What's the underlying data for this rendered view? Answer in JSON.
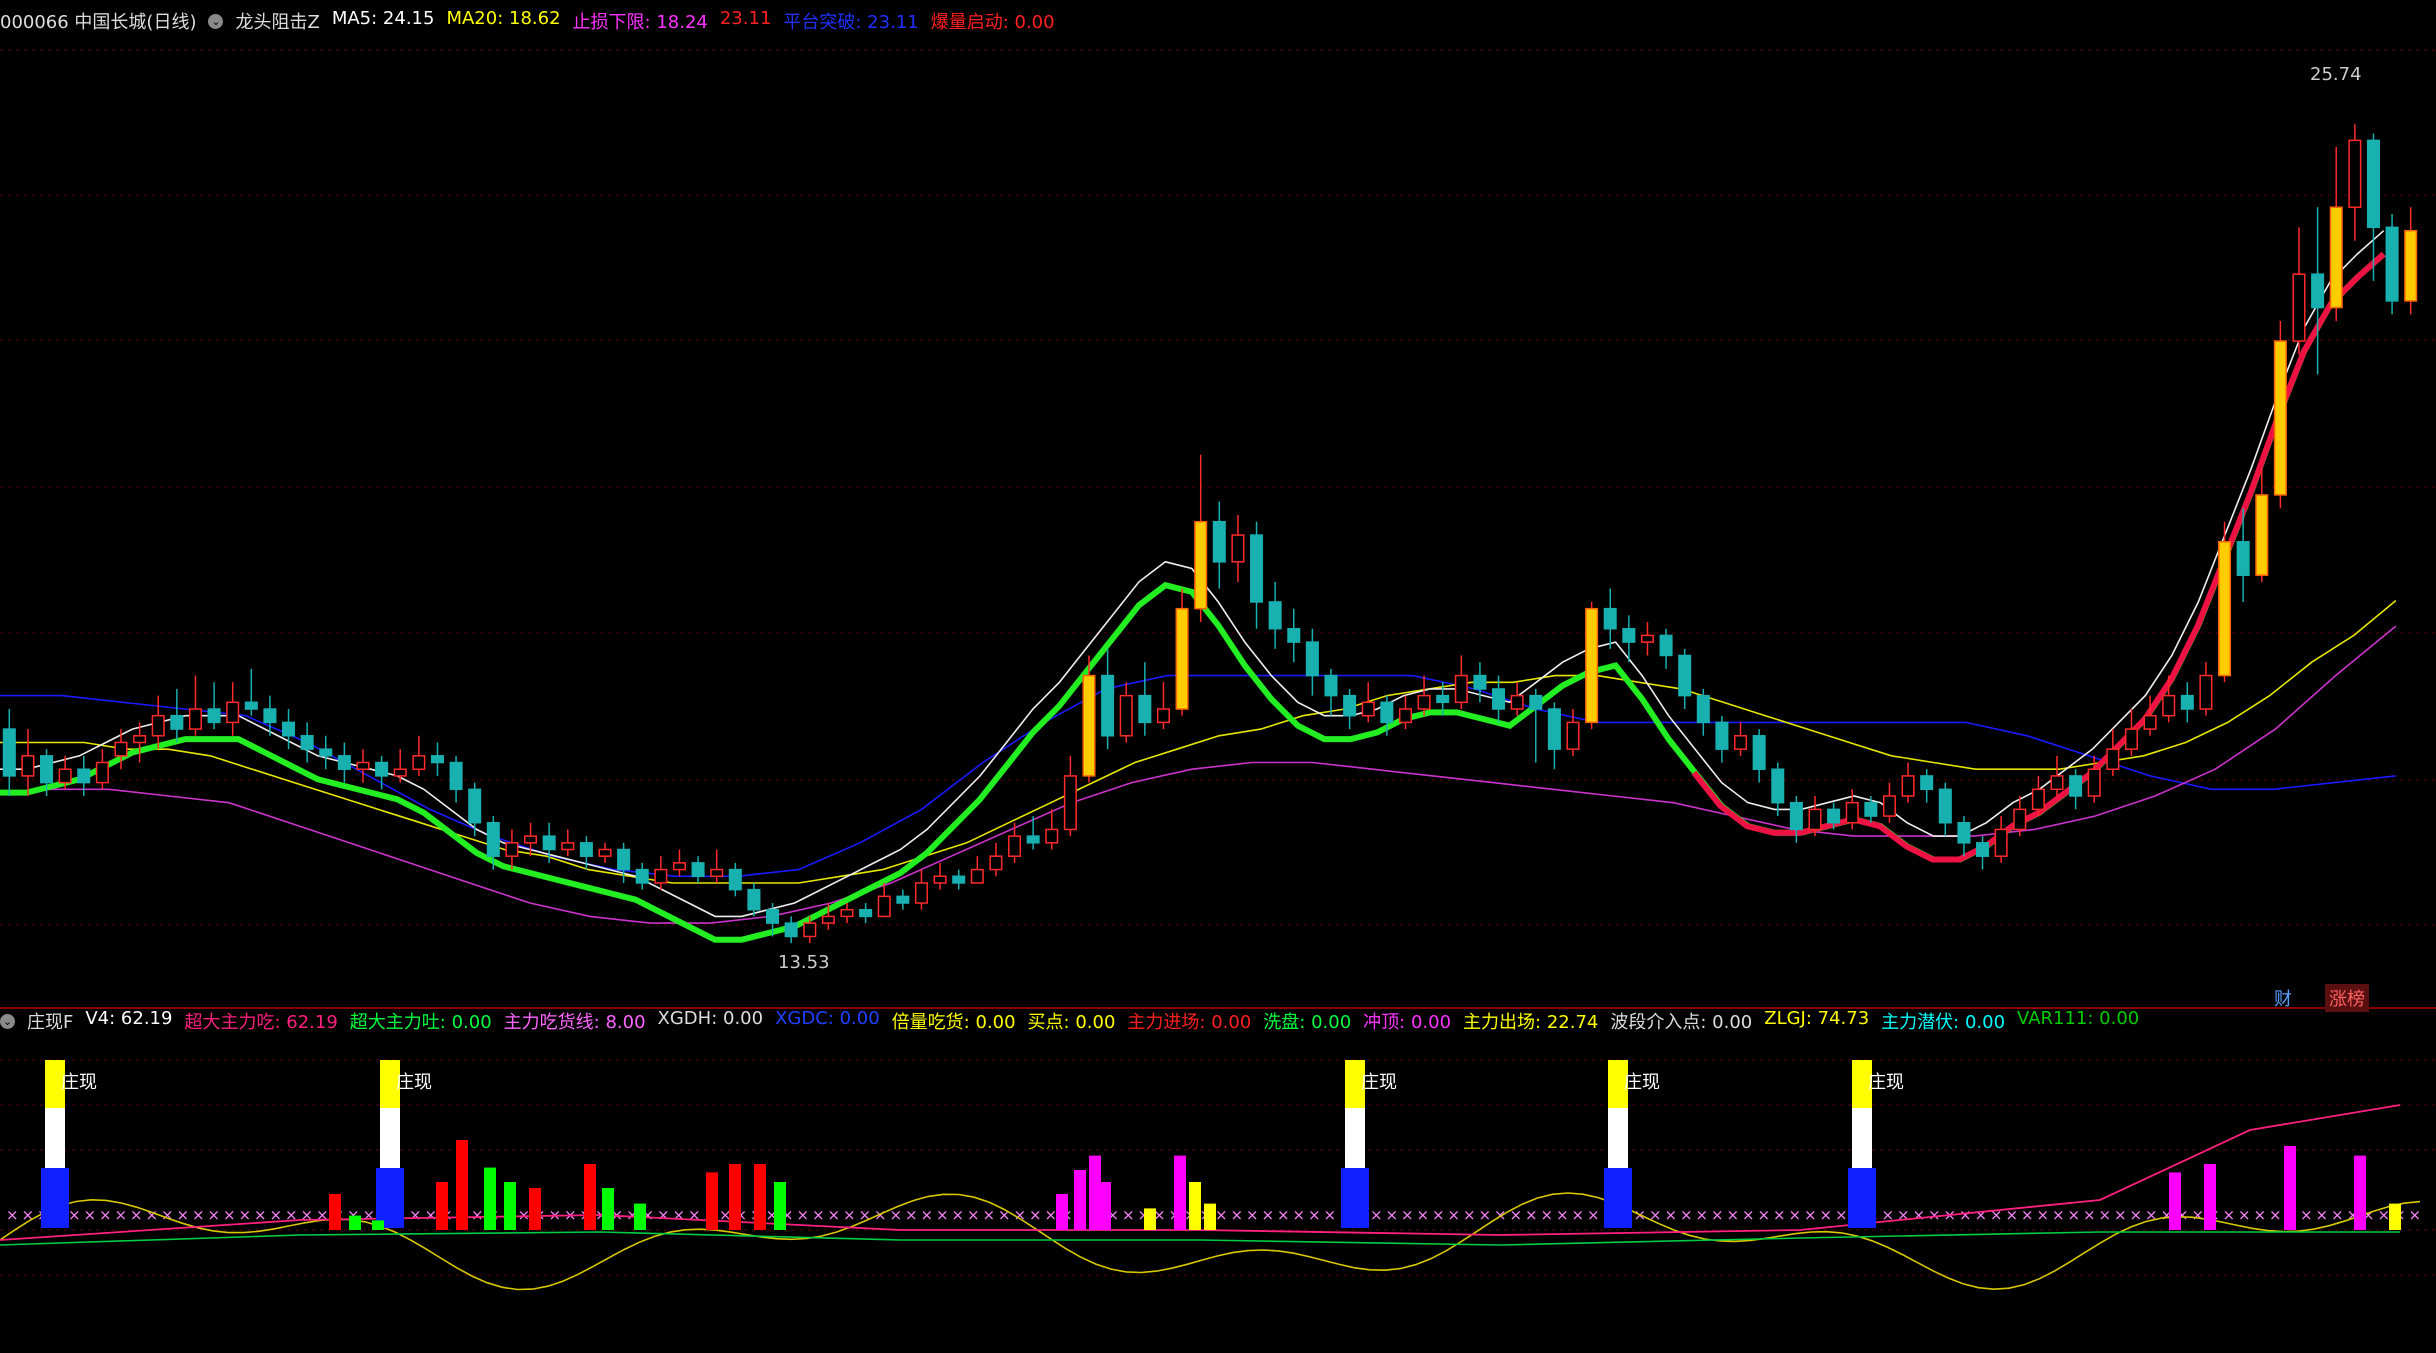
{
  "main_header": {
    "stock": "000066 中国长城(日线)",
    "indicator": "龙头阻击Z",
    "items": [
      {
        "label": "MA5: 24.15",
        "color": "#ffffff"
      },
      {
        "label": "MA20: 18.62",
        "color": "#ffff00"
      },
      {
        "label": "止损下限: 18.24",
        "color": "#ff33ff"
      },
      {
        "label": "23.11",
        "color": "#ff2020"
      },
      {
        "label": "平台突破: 23.11",
        "color": "#2030ff"
      },
      {
        "label": "爆量启动: 0.00",
        "color": "#ff2020"
      }
    ]
  },
  "indicator_header": {
    "name": "庄现F",
    "items": [
      {
        "label": "V4: 62.19",
        "color": "#ffffff"
      },
      {
        "label": "超大主力吃: 62.19",
        "color": "#ff2080"
      },
      {
        "label": "超大主力吐: 0.00",
        "color": "#00ff40"
      },
      {
        "label": "主力吃货线: 8.00",
        "color": "#ff66ff"
      },
      {
        "label": "XGDH: 0.00",
        "color": "#dddddd"
      },
      {
        "label": "XGDC: 0.00",
        "color": "#2040ff"
      },
      {
        "label": "倍量吃货: 0.00",
        "color": "#ffff00"
      },
      {
        "label": "买点: 0.00",
        "color": "#ffff00"
      },
      {
        "label": "主力进场: 0.00",
        "color": "#ff2020"
      },
      {
        "label": "洗盘: 0.00",
        "color": "#00ff40"
      },
      {
        "label": "冲顶: 0.00",
        "color": "#ff33ff"
      },
      {
        "label": "主力出场: 22.74",
        "color": "#ffff00"
      },
      {
        "label": "波段介入点: 0.00",
        "color": "#dddddd"
      },
      {
        "label": "ZLGJ: 74.73",
        "color": "#ffff00"
      },
      {
        "label": "主力潜伏: 0.00",
        "color": "#00ffff"
      },
      {
        "label": "VAR111: 0.00",
        "color": "#00cc00"
      }
    ]
  },
  "badges": {
    "cai": "财",
    "zhang": "涨榜"
  },
  "chart_data": {
    "type": "candlestick",
    "stock": "000066 中国长城",
    "high_label": "25.74",
    "low_label": "13.53",
    "ylim": [
      12.8,
      27.0
    ],
    "candles": [
      [
        16.7,
        16.0,
        17.0,
        15.7
      ],
      [
        16.0,
        16.3,
        16.7,
        15.7
      ],
      [
        16.3,
        15.9,
        16.4,
        15.7
      ],
      [
        15.9,
        16.1,
        16.3,
        15.8
      ],
      [
        16.1,
        15.9,
        16.3,
        15.7
      ],
      [
        15.9,
        16.2,
        16.4,
        15.8
      ],
      [
        16.3,
        16.5,
        16.7,
        16.1
      ],
      [
        16.5,
        16.6,
        16.8,
        16.2
      ],
      [
        16.6,
        16.9,
        17.2,
        16.4
      ],
      [
        16.9,
        16.7,
        17.3,
        16.5
      ],
      [
        16.7,
        17.0,
        17.5,
        16.6
      ],
      [
        17.0,
        16.8,
        17.4,
        16.7
      ],
      [
        16.8,
        17.1,
        17.4,
        16.6
      ],
      [
        17.1,
        17.0,
        17.6,
        16.9
      ],
      [
        17.0,
        16.8,
        17.2,
        16.6
      ],
      [
        16.8,
        16.6,
        17.0,
        16.4
      ],
      [
        16.6,
        16.4,
        16.8,
        16.2
      ],
      [
        16.4,
        16.3,
        16.6,
        16.1
      ],
      [
        16.3,
        16.1,
        16.5,
        15.9
      ],
      [
        16.1,
        16.2,
        16.4,
        15.9
      ],
      [
        16.2,
        16.0,
        16.3,
        15.8
      ],
      [
        16.0,
        16.1,
        16.4,
        15.9
      ],
      [
        16.1,
        16.3,
        16.6,
        16.0
      ],
      [
        16.3,
        16.2,
        16.5,
        16.0
      ],
      [
        16.2,
        15.8,
        16.3,
        15.6
      ],
      [
        15.8,
        15.3,
        15.9,
        15.1
      ],
      [
        15.3,
        14.8,
        15.4,
        14.6
      ],
      [
        14.8,
        15.0,
        15.2,
        14.6
      ],
      [
        15.0,
        15.1,
        15.3,
        14.8
      ],
      [
        15.1,
        14.9,
        15.3,
        14.7
      ],
      [
        14.9,
        15.0,
        15.2,
        14.8
      ],
      [
        15.0,
        14.8,
        15.1,
        14.6
      ],
      [
        14.8,
        14.9,
        15.0,
        14.7
      ],
      [
        14.9,
        14.6,
        15.0,
        14.4
      ],
      [
        14.6,
        14.4,
        14.7,
        14.3
      ],
      [
        14.4,
        14.6,
        14.8,
        14.3
      ],
      [
        14.6,
        14.7,
        14.9,
        14.5
      ],
      [
        14.7,
        14.5,
        14.8,
        14.4
      ],
      [
        14.5,
        14.6,
        14.9,
        14.4
      ],
      [
        14.6,
        14.3,
        14.7,
        14.2
      ],
      [
        14.3,
        14.0,
        14.4,
        13.9
      ],
      [
        14.0,
        13.8,
        14.1,
        13.6
      ],
      [
        13.8,
        13.6,
        13.9,
        13.5
      ],
      [
        13.6,
        13.8,
        13.9,
        13.5
      ],
      [
        13.8,
        13.9,
        14.1,
        13.7
      ],
      [
        13.9,
        14.0,
        14.1,
        13.8
      ],
      [
        14.0,
        13.9,
        14.1,
        13.8
      ],
      [
        13.9,
        14.2,
        14.4,
        13.9
      ],
      [
        14.2,
        14.1,
        14.3,
        14.0
      ],
      [
        14.1,
        14.4,
        14.6,
        14.0
      ],
      [
        14.4,
        14.5,
        14.7,
        14.3
      ],
      [
        14.5,
        14.4,
        14.6,
        14.3
      ],
      [
        14.4,
        14.6,
        14.8,
        14.4
      ],
      [
        14.6,
        14.8,
        15.0,
        14.5
      ],
      [
        14.8,
        15.1,
        15.3,
        14.7
      ],
      [
        15.1,
        15.0,
        15.4,
        14.9
      ],
      [
        15.0,
        15.2,
        15.5,
        14.9
      ],
      [
        15.2,
        16.0,
        16.3,
        15.1
      ],
      [
        16.0,
        17.5,
        17.8,
        15.9
      ],
      [
        17.5,
        16.6,
        17.9,
        16.4
      ],
      [
        16.6,
        17.2,
        17.4,
        16.5
      ],
      [
        17.2,
        16.8,
        17.7,
        16.6
      ],
      [
        16.8,
        17.0,
        17.4,
        16.7
      ],
      [
        17.0,
        18.5,
        18.8,
        16.9
      ],
      [
        18.5,
        19.8,
        20.8,
        18.3
      ],
      [
        19.8,
        19.2,
        20.1,
        18.8
      ],
      [
        19.2,
        19.6,
        19.9,
        18.9
      ],
      [
        19.6,
        18.6,
        19.8,
        18.2
      ],
      [
        18.6,
        18.2,
        18.9,
        17.9
      ],
      [
        18.2,
        18.0,
        18.5,
        17.7
      ],
      [
        18.0,
        17.5,
        18.2,
        17.2
      ],
      [
        17.5,
        17.2,
        17.6,
        16.9
      ],
      [
        17.2,
        16.9,
        17.3,
        16.7
      ],
      [
        16.9,
        17.1,
        17.4,
        16.8
      ],
      [
        17.1,
        16.8,
        17.2,
        16.6
      ],
      [
        16.8,
        17.0,
        17.2,
        16.7
      ],
      [
        17.0,
        17.2,
        17.5,
        16.9
      ],
      [
        17.2,
        17.1,
        17.4,
        16.9
      ],
      [
        17.1,
        17.5,
        17.8,
        17.0
      ],
      [
        17.5,
        17.3,
        17.7,
        17.1
      ],
      [
        17.3,
        17.0,
        17.5,
        16.8
      ],
      [
        17.0,
        17.2,
        17.4,
        16.9
      ],
      [
        17.2,
        17.0,
        17.3,
        16.2
      ],
      [
        17.0,
        16.4,
        17.1,
        16.1
      ],
      [
        16.4,
        16.8,
        17.0,
        16.3
      ],
      [
        16.8,
        18.5,
        18.6,
        16.7
      ],
      [
        18.5,
        18.2,
        18.8,
        17.9
      ],
      [
        18.2,
        18.0,
        18.4,
        17.7
      ],
      [
        18.0,
        18.1,
        18.3,
        17.8
      ],
      [
        18.1,
        17.8,
        18.2,
        17.6
      ],
      [
        17.8,
        17.2,
        17.9,
        17.0
      ],
      [
        17.2,
        16.8,
        17.3,
        16.6
      ],
      [
        16.8,
        16.4,
        16.9,
        16.2
      ],
      [
        16.4,
        16.6,
        16.8,
        16.3
      ],
      [
        16.6,
        16.1,
        16.7,
        15.9
      ],
      [
        16.1,
        15.6,
        16.2,
        15.4
      ],
      [
        15.6,
        15.2,
        15.7,
        15.0
      ],
      [
        15.2,
        15.5,
        15.7,
        15.1
      ],
      [
        15.5,
        15.3,
        15.6,
        15.2
      ],
      [
        15.3,
        15.6,
        15.8,
        15.2
      ],
      [
        15.6,
        15.4,
        15.7,
        15.3
      ],
      [
        15.4,
        15.7,
        15.9,
        15.3
      ],
      [
        15.7,
        16.0,
        16.2,
        15.6
      ],
      [
        16.0,
        15.8,
        16.1,
        15.6
      ],
      [
        15.8,
        15.3,
        15.9,
        15.1
      ],
      [
        15.3,
        15.0,
        15.4,
        14.8
      ],
      [
        15.0,
        14.8,
        15.1,
        14.6
      ],
      [
        14.8,
        15.2,
        15.4,
        14.7
      ],
      [
        15.2,
        15.5,
        15.7,
        15.1
      ],
      [
        15.5,
        15.8,
        16.0,
        15.4
      ],
      [
        15.8,
        16.0,
        16.3,
        15.7
      ],
      [
        16.0,
        15.7,
        16.1,
        15.5
      ],
      [
        15.7,
        16.1,
        16.3,
        15.6
      ],
      [
        16.1,
        16.4,
        16.7,
        16.0
      ],
      [
        16.4,
        16.7,
        17.0,
        16.3
      ],
      [
        16.7,
        16.9,
        17.2,
        16.6
      ],
      [
        16.9,
        17.2,
        17.5,
        16.8
      ],
      [
        17.2,
        17.0,
        17.4,
        16.8
      ],
      [
        17.0,
        17.5,
        17.7,
        16.9
      ],
      [
        17.5,
        19.5,
        19.8,
        17.4
      ],
      [
        19.5,
        19.0,
        20.0,
        18.6
      ],
      [
        19.0,
        20.2,
        20.6,
        18.9
      ],
      [
        20.2,
        22.5,
        22.8,
        20.0
      ],
      [
        22.5,
        23.5,
        24.2,
        22.3
      ],
      [
        23.5,
        23.0,
        24.5,
        22.0
      ],
      [
        23.0,
        24.5,
        25.4,
        22.8
      ],
      [
        24.5,
        25.5,
        25.74,
        24.0
      ],
      [
        25.5,
        24.2,
        25.6,
        23.4
      ],
      [
        24.2,
        23.1,
        24.4,
        22.9
      ],
      [
        23.1,
        24.15,
        24.5,
        22.9
      ]
    ],
    "ma5": [
      16.1,
      16.1,
      16.2,
      16.3,
      16.5,
      16.7,
      16.8,
      16.9,
      16.9,
      16.9,
      16.7,
      16.5,
      16.3,
      16.2,
      16.1,
      16.0,
      15.8,
      15.5,
      15.2,
      15.0,
      14.9,
      14.8,
      14.7,
      14.6,
      14.5,
      14.3,
      14.1,
      13.9,
      13.9,
      14.0,
      14.1,
      14.3,
      14.5,
      14.7,
      14.9,
      15.2,
      15.6,
      16.0,
      16.5,
      17.0,
      17.4,
      17.9,
      18.4,
      18.9,
      19.2,
      19.1,
      18.6,
      18.0,
      17.5,
      17.1,
      16.9,
      16.9,
      17.0,
      17.2,
      17.3,
      17.3,
      17.2,
      17.1,
      17.4,
      17.7,
      17.9,
      18.0,
      17.5,
      16.9,
      16.4,
      15.9,
      15.6,
      15.5,
      15.5,
      15.6,
      15.7,
      15.6,
      15.3,
      15.1,
      15.1,
      15.3,
      15.6,
      15.8,
      16.1,
      16.4,
      16.8,
      17.2,
      17.8,
      18.6,
      19.6,
      20.6,
      21.7,
      22.7,
      23.4,
      23.8,
      24.15
    ],
    "ma20": [
      16.5,
      16.5,
      16.5,
      16.4,
      16.4,
      16.3,
      16.1,
      15.9,
      15.7,
      15.5,
      15.3,
      15.1,
      14.9,
      14.8,
      14.6,
      14.5,
      14.4,
      14.4,
      14.4,
      14.4,
      14.5,
      14.6,
      14.8,
      15.0,
      15.3,
      15.6,
      15.9,
      16.2,
      16.4,
      16.6,
      16.7,
      16.9,
      17.0,
      17.2,
      17.3,
      17.4,
      17.4,
      17.5,
      17.5,
      17.4,
      17.3,
      17.1,
      16.9,
      16.7,
      16.5,
      16.3,
      16.2,
      16.1,
      16.1,
      16.1,
      16.2,
      16.3,
      16.5,
      16.8,
      17.2,
      17.7,
      18.1,
      18.62
    ],
    "band_upper": [
      17.2,
      17.2,
      17.1,
      17.0,
      16.9,
      16.5,
      16.0,
      15.5,
      15.1,
      14.8,
      14.6,
      14.5,
      14.5,
      14.6,
      15.0,
      15.5,
      16.2,
      16.8,
      17.3,
      17.5,
      17.5,
      17.5,
      17.5,
      17.5,
      17.3,
      17.0,
      16.8,
      16.8,
      16.8,
      16.8,
      16.8,
      16.8,
      16.8,
      16.6,
      16.3,
      16.0,
      15.8,
      15.8,
      15.9,
      16.0
    ],
    "stop_low": [
      15.8,
      15.8,
      15.7,
      15.6,
      15.3,
      15.0,
      14.7,
      14.4,
      14.1,
      13.9,
      13.8,
      13.8,
      13.9,
      14.1,
      14.4,
      14.8,
      15.2,
      15.6,
      15.9,
      16.1,
      16.2,
      16.2,
      16.1,
      16.0,
      15.9,
      15.8,
      15.7,
      15.6,
      15.4,
      15.2,
      15.1,
      15.1,
      15.1,
      15.2,
      15.4,
      15.7,
      16.1,
      16.7,
      17.5,
      18.24
    ],
    "indicator": {
      "ylim": [
        -80,
        110
      ],
      "bars": [
        [
          30,
          "#ff0000"
        ],
        [
          12,
          "#00ff00"
        ],
        [
          8,
          "#00ff00"
        ],
        [
          40,
          "#ff0000"
        ],
        [
          75,
          "#ff0000"
        ],
        [
          52,
          "#00ff00"
        ],
        [
          40,
          "#00ff00"
        ],
        [
          35,
          "#ff0000"
        ],
        [
          55,
          "#ff0000"
        ],
        [
          35,
          "#00ff00"
        ],
        [
          22,
          "#00ff00"
        ],
        [
          48,
          "#ff0000"
        ],
        [
          55,
          "#ff0000"
        ],
        [
          55,
          "#ff0000"
        ],
        [
          40,
          "#00ff00"
        ],
        [
          30,
          "#ff00ff"
        ],
        [
          50,
          "#ff00ff"
        ],
        [
          62,
          "#ff00ff"
        ],
        [
          40,
          "#ff00ff"
        ],
        [
          18,
          "#ffff00"
        ],
        [
          62,
          "#ff00ff"
        ],
        [
          40,
          "#ffff00"
        ],
        [
          22,
          "#ffff00"
        ],
        [
          48,
          "#ff00ff"
        ],
        [
          55,
          "#ff00ff"
        ],
        [
          70,
          "#ff00ff"
        ],
        [
          62,
          "#ff00ff"
        ],
        [
          22,
          "#ffff00"
        ]
      ],
      "zhuangxian_label": "庄现"
    }
  }
}
